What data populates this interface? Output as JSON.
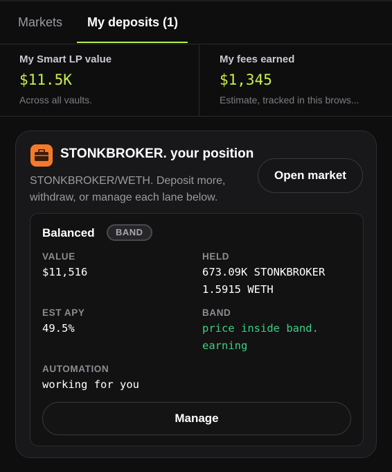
{
  "tabs": [
    {
      "label": "Markets",
      "active": false
    },
    {
      "label": "My deposits (1)",
      "active": true
    }
  ],
  "accent_color": "#b6f04a",
  "stats": {
    "lp_value": {
      "label": "My Smart LP value",
      "value": "$11.5K",
      "sub": "Across all vaults."
    },
    "fees": {
      "label": "My fees earned",
      "value": "$1,345",
      "sub": "Estimate, tracked in this brows..."
    }
  },
  "position": {
    "icon": "briefcase-icon",
    "icon_color": "#f47a2a",
    "title": "STONKBROKER. your position",
    "description": "STONKBROKER/WETH. Deposit more, withdraw, or manage each lane below.",
    "open_market_label": "Open market",
    "lane": {
      "name": "Balanced",
      "badge": "BAND",
      "value_label": "VALUE",
      "value": "$11,516",
      "held_label": "HELD",
      "held": [
        "673.09K STONKBROKER",
        "1.5915 WETH"
      ],
      "apy_label": "EST APY",
      "apy": "49.5%",
      "band_label": "BAND",
      "band_status": [
        "price inside band.",
        "earning"
      ],
      "band_status_color": "#3fcf7f",
      "automation_label": "AUTOMATION",
      "automation": "working for you",
      "manage_label": "Manage"
    }
  }
}
